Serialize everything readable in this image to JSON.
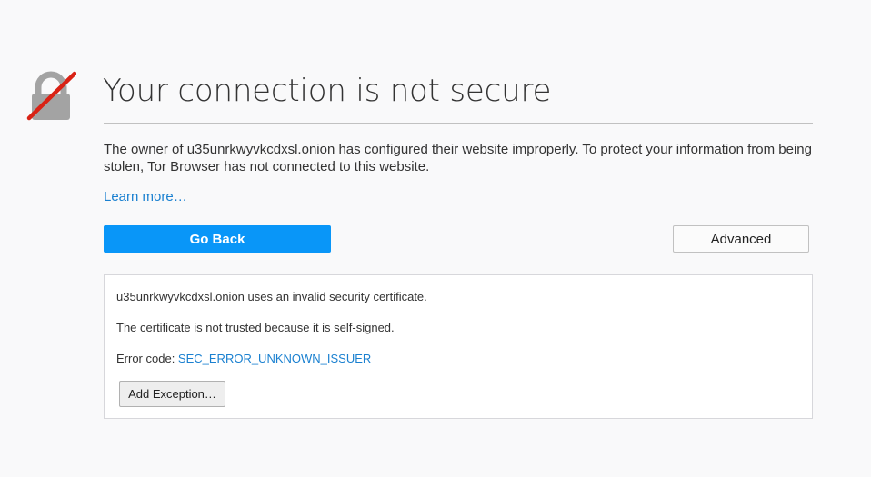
{
  "page": {
    "title": "Your connection is not secure",
    "description": "The owner of u35unrkwyvkcdxsl.onion has configured their website improperly. To protect your information from being stolen, Tor Browser has not connected to this website.",
    "learn_more": "Learn more…",
    "icon": "broken-lock-icon"
  },
  "buttons": {
    "go_back": "Go Back",
    "advanced": "Advanced",
    "add_exception": "Add Exception…"
  },
  "details": {
    "line1": "u35unrkwyvkcdxsl.onion uses an invalid security certificate.",
    "line2": "The certificate is not trusted because it is self-signed.",
    "error_code_label": "Error code: ",
    "error_code": "SEC_ERROR_UNKNOWN_ISSUER"
  },
  "colors": {
    "primary_button": "#0996f8",
    "link": "#1a80d0",
    "strike": "#d92215",
    "lock": "#a3a3a3",
    "background": "#f9f9fa"
  }
}
